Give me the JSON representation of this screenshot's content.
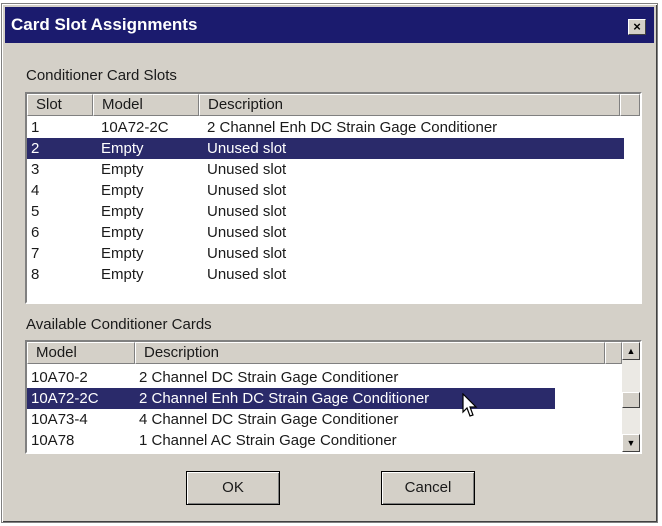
{
  "window": {
    "title": "Card Slot Assignments",
    "close_glyph": "×"
  },
  "slots_section": {
    "label": "Conditioner Card Slots",
    "columns": [
      "Slot",
      "Model",
      "Description"
    ],
    "rows": [
      {
        "slot": "1",
        "model": "10A72-2C",
        "description": "2 Channel Enh DC Strain Gage Conditioner"
      },
      {
        "slot": "2",
        "model": "Empty",
        "description": "Unused slot"
      },
      {
        "slot": "3",
        "model": "Empty",
        "description": "Unused slot"
      },
      {
        "slot": "4",
        "model": "Empty",
        "description": "Unused slot"
      },
      {
        "slot": "5",
        "model": "Empty",
        "description": "Unused slot"
      },
      {
        "slot": "6",
        "model": "Empty",
        "description": "Unused slot"
      },
      {
        "slot": "7",
        "model": "Empty",
        "description": "Unused slot"
      },
      {
        "slot": "8",
        "model": "Empty",
        "description": "Unused slot"
      }
    ],
    "selected_index": 1
  },
  "cards_section": {
    "label": "Available Conditioner Cards",
    "columns": [
      "Model",
      "Description"
    ],
    "rows": [
      {
        "model": "10A70-2",
        "description": "2 Channel DC Strain Gage Conditioner"
      },
      {
        "model": "10A72-2C",
        "description": "2 Channel Enh DC Strain Gage Conditioner"
      },
      {
        "model": "10A73-4",
        "description": "4 Channel DC Strain Gage Conditioner"
      },
      {
        "model": "10A78",
        "description": "1 Channel AC Strain Gage Conditioner"
      }
    ],
    "selected_index": 1
  },
  "buttons": {
    "ok": "OK",
    "cancel": "Cancel"
  },
  "icons": {
    "scroll_up": "up-arrow-icon",
    "scroll_down": "down-arrow-icon",
    "cursor": "mouse-pointer-icon"
  },
  "colors": {
    "titlebar": "#1b1b6e",
    "selection": "#2a2a6a",
    "face": "#d4d0c8"
  }
}
